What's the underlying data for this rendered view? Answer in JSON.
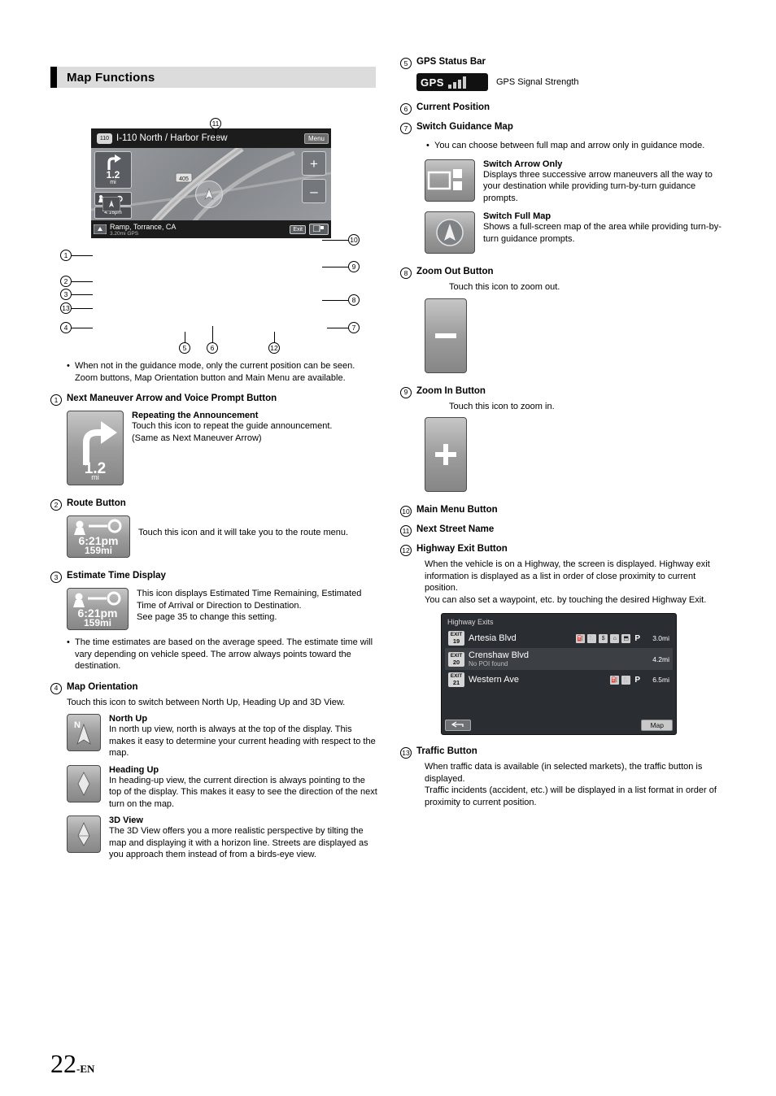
{
  "page": {
    "title": "Map Functions",
    "number": "22",
    "number_suffix": "-EN"
  },
  "figure": {
    "street_name": "I-110 North / Harbor Freew",
    "route_badge": "110",
    "menu_label": "Menu",
    "distance": "1.2",
    "distance_unit": "mi",
    "eta_time": "4:16pm",
    "eta_dist": "25mi",
    "bottom_label": "Ramp, Torrance, CA",
    "bottom_sub": "3.20mi                GPS",
    "exit_label": "Exit",
    "zoom_in": "+",
    "zoom_out": "–",
    "callouts": [
      "1",
      "2",
      "3",
      "4",
      "5",
      "6",
      "7",
      "8",
      "9",
      "10",
      "11",
      "12",
      "13"
    ]
  },
  "left": {
    "note_bullet": "When not in the guidance mode, only the current position can be seen. Zoom buttons, Map Orientation button and Main Menu are available.",
    "item1": {
      "num": "1",
      "title": "Next Maneuver Arrow and Voice Prompt Button",
      "sub": "Repeating the Announcement",
      "body": "Touch this icon to repeat the guide announcement.\n(Same as Next Maneuver Arrow)",
      "icon_distance": "1.2",
      "icon_unit": "mi"
    },
    "item2": {
      "num": "2",
      "title": "Route Button",
      "body": "Touch this icon and it will take you to the route menu.",
      "icon_time": "6:21pm",
      "icon_dist": "159mi"
    },
    "item3": {
      "num": "3",
      "title": "Estimate Time Display",
      "body": "This icon displays Estimated Time Remaining, Estimated Time of Arrival or Direction to Destination.\nSee page 35 to change this setting.",
      "icon_time": "6:21pm",
      "icon_dist": "159mi",
      "bullet": "The time estimates are based on the average speed. The estimate time will vary depending on vehicle speed. The arrow always points toward the destination."
    },
    "item4": {
      "num": "4",
      "title": "Map Orientation",
      "body": "Touch this icon to switch between North Up, Heading Up and 3D View.",
      "modes": [
        {
          "name": "North Up",
          "desc": "In north up view, north is always at the top of the display. This makes it easy to determine your current heading with respect to the map.",
          "icon_letter": "N"
        },
        {
          "name": "Heading Up",
          "desc": "In heading-up view, the current direction is always pointing to the top of the display. This makes it easy to see the direction of the next turn on the map.",
          "icon_letter": ""
        },
        {
          "name": "3D View",
          "desc": "The 3D View offers you a more realistic perspective by tilting the map and displaying it with a horizon line. Streets are displayed as you approach them instead of from a birds-eye view.",
          "icon_letter": ""
        }
      ]
    }
  },
  "right": {
    "item5": {
      "num": "5",
      "title": "GPS Status Bar",
      "gps_label": "GPS",
      "caption": "GPS Signal Strength"
    },
    "item6": {
      "num": "6",
      "title": "Current Position"
    },
    "item7": {
      "num": "7",
      "title": "Switch Guidance Map",
      "bullet": "You can choose between full map and arrow only in guidance mode.",
      "modes": [
        {
          "name": "Switch Arrow Only",
          "desc": "Displays three successive arrow maneuvers all the way to your destination while providing turn-by-turn guidance prompts."
        },
        {
          "name": "Switch Full Map",
          "desc": "Shows a full-screen map of the area while providing turn-by-turn guidance prompts."
        }
      ]
    },
    "item8": {
      "num": "8",
      "title": "Zoom Out Button",
      "body": "Touch this icon to zoom out.",
      "glyph": "–"
    },
    "item9": {
      "num": "9",
      "title": "Zoom In Button",
      "body": "Touch this icon to zoom in.",
      "glyph": "+"
    },
    "item10": {
      "num": "10",
      "title": "Main Menu Button"
    },
    "item11": {
      "num": "11",
      "title": "Next Street Name"
    },
    "item12": {
      "num": "12",
      "title": "Highway Exit Button",
      "body": "When the vehicle is on a Highway, the screen is displayed. Highway exit information is displayed as a list in order of close proximity to current position.\nYou can also set a waypoint, etc. by touching the desired Highway Exit."
    },
    "item13": {
      "num": "13",
      "title": "Traffic Button",
      "body": "When traffic data is available (in selected markets), the traffic button is displayed.\nTraffic incidents (accident, etc.) will be displayed in a list format in order of proximity to current position."
    },
    "highway_panel": {
      "title": "Highway Exits",
      "back_label": "",
      "map_label": "Map",
      "rows": [
        {
          "exit_label": "EXIT",
          "exit_num": "19",
          "name": "Artesia Blvd",
          "sub": "",
          "dist": "3.0mi",
          "icons": [
            "fuel",
            "fork",
            "$",
            "bed",
            "car",
            "P"
          ]
        },
        {
          "exit_label": "EXIT",
          "exit_num": "20",
          "name": "Crenshaw Blvd",
          "sub": "No POI found",
          "dist": "4.2mi",
          "icons": []
        },
        {
          "exit_label": "EXIT",
          "exit_num": "21",
          "name": "Western Ave",
          "sub": "",
          "dist": "6.5mi",
          "icons": [
            "fuel",
            "fork",
            "P"
          ]
        }
      ]
    }
  }
}
